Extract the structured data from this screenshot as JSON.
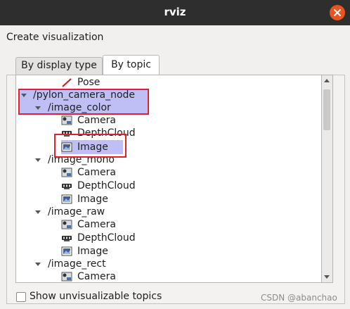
{
  "window": {
    "title": "rviz",
    "close_icon": "close-icon"
  },
  "section": {
    "label": "Create visualization"
  },
  "tabs": [
    {
      "label": "By display type",
      "active": false
    },
    {
      "label": "By topic",
      "active": true
    }
  ],
  "tree": {
    "items": [
      {
        "label": "Pose",
        "icon": "pose-arrow-icon",
        "level": 2
      },
      {
        "label": "/pylon_camera_node",
        "icon": "expand-arrow-icon",
        "level": 0,
        "expanded": true,
        "selected": true
      },
      {
        "label": "/image_color",
        "icon": "expand-arrow-icon",
        "level": 1,
        "expanded": true,
        "selected": true
      },
      {
        "label": "Camera",
        "icon": "camera-icon",
        "level": 2
      },
      {
        "label": "DepthCloud",
        "icon": "depthcloud-icon",
        "level": 2
      },
      {
        "label": "Image",
        "icon": "image-icon",
        "level": 2,
        "selected": true
      },
      {
        "label": "/image_mono",
        "icon": "expand-arrow-icon",
        "level": 1,
        "expanded": true
      },
      {
        "label": "Camera",
        "icon": "camera-icon",
        "level": 2
      },
      {
        "label": "DepthCloud",
        "icon": "depthcloud-icon",
        "level": 2
      },
      {
        "label": "Image",
        "icon": "image-icon",
        "level": 2
      },
      {
        "label": "/image_raw",
        "icon": "expand-arrow-icon",
        "level": 1,
        "expanded": true
      },
      {
        "label": "Camera",
        "icon": "camera-icon",
        "level": 2
      },
      {
        "label": "DepthCloud",
        "icon": "depthcloud-icon",
        "level": 2
      },
      {
        "label": "Image",
        "icon": "image-icon",
        "level": 2
      },
      {
        "label": "/image_rect",
        "icon": "expand-arrow-icon",
        "level": 1,
        "expanded": true
      },
      {
        "label": "Camera",
        "icon": "camera-icon",
        "level": 2
      }
    ]
  },
  "options": {
    "show_unvisualizable_label": "Show unvisualizable topics",
    "show_unvisualizable_checked": false
  },
  "watermark": {
    "text": "CSDN @abanchao"
  },
  "colors": {
    "titlebar": "#2e2e2e",
    "close_button": "#e95420",
    "selection": "#bfbff5",
    "annotation_box": "#e0202a"
  }
}
